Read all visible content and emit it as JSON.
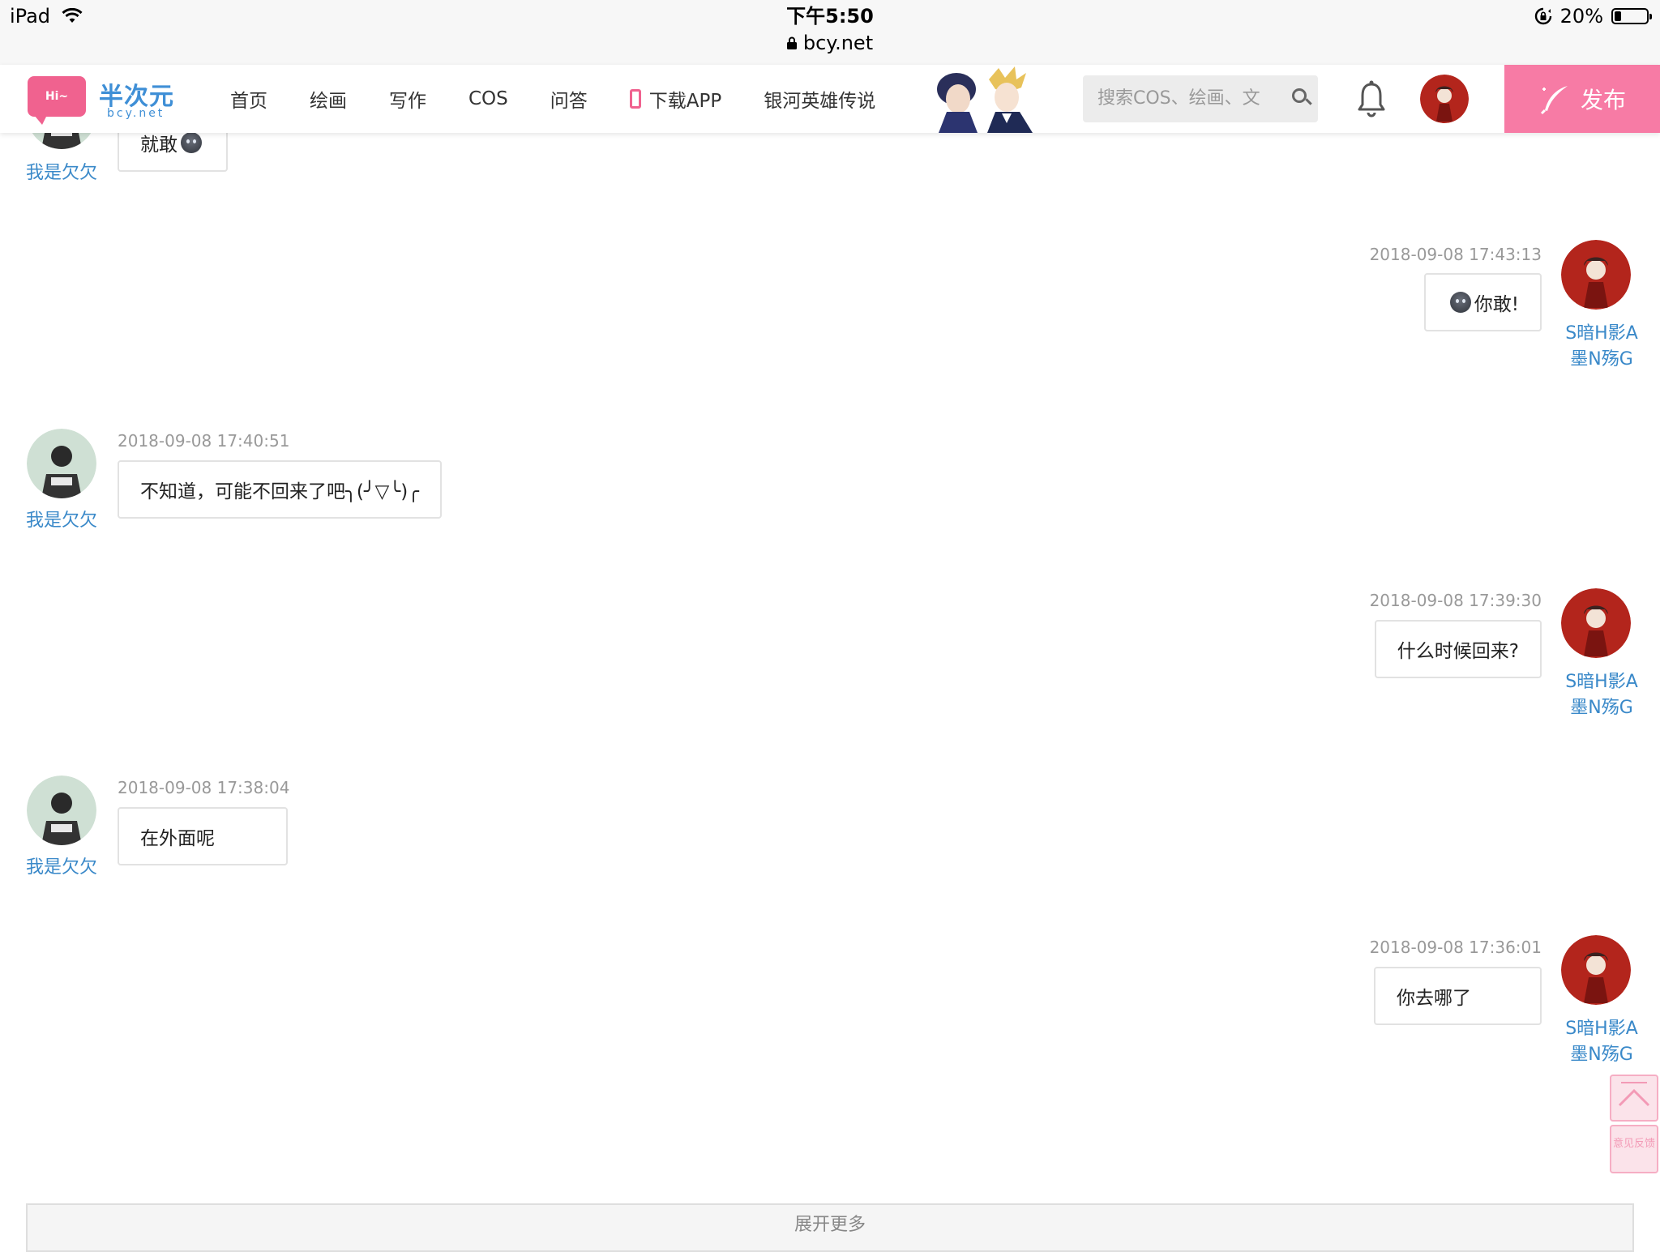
{
  "statusbar": {
    "device": "iPad",
    "time": "下午5:50",
    "url": "bcy.net",
    "battery": "20%",
    "battery_level": 0.2
  },
  "header": {
    "logo_badge": "Hi~",
    "logo_title": "半次元",
    "logo_sub": "bcy.net",
    "nav": [
      "首页",
      "绘画",
      "写作",
      "COS",
      "问答",
      "下载APP",
      "银河英雄传说"
    ],
    "search_placeholder": "搜索COS、绘画、文",
    "publish": "发布"
  },
  "messages": [
    {
      "side": "left",
      "user": "我是欠欠",
      "time": "",
      "text": "就敢",
      "emoji": "after"
    },
    {
      "side": "right",
      "user": "S暗H影A墨N殇G",
      "time": "2018-09-08 17:43:13",
      "text": "你敢!",
      "emoji": "before"
    },
    {
      "side": "left",
      "user": "我是欠欠",
      "time": "2018-09-08 17:40:51",
      "text": "不知道，可能不回来了吧╮(╯▽╰)╭",
      "emoji": ""
    },
    {
      "side": "right",
      "user": "S暗H影A墨N殇G",
      "time": "2018-09-08 17:39:30",
      "text": "什么时候回来?",
      "emoji": ""
    },
    {
      "side": "left",
      "user": "我是欠欠",
      "time": "2018-09-08 17:38:04",
      "text": "在外面呢",
      "emoji": ""
    },
    {
      "side": "right",
      "user": "S暗H影A墨N殇G",
      "time": "2018-09-08 17:36:01",
      "text": "你去哪了",
      "emoji": ""
    }
  ],
  "side": {
    "feedback": "意见反馈"
  },
  "load_more": "展开更多",
  "colors": {
    "accent_pink": "#f77ba5",
    "link_blue": "#3a89c9",
    "logo_blue": "#3f8fd6"
  }
}
